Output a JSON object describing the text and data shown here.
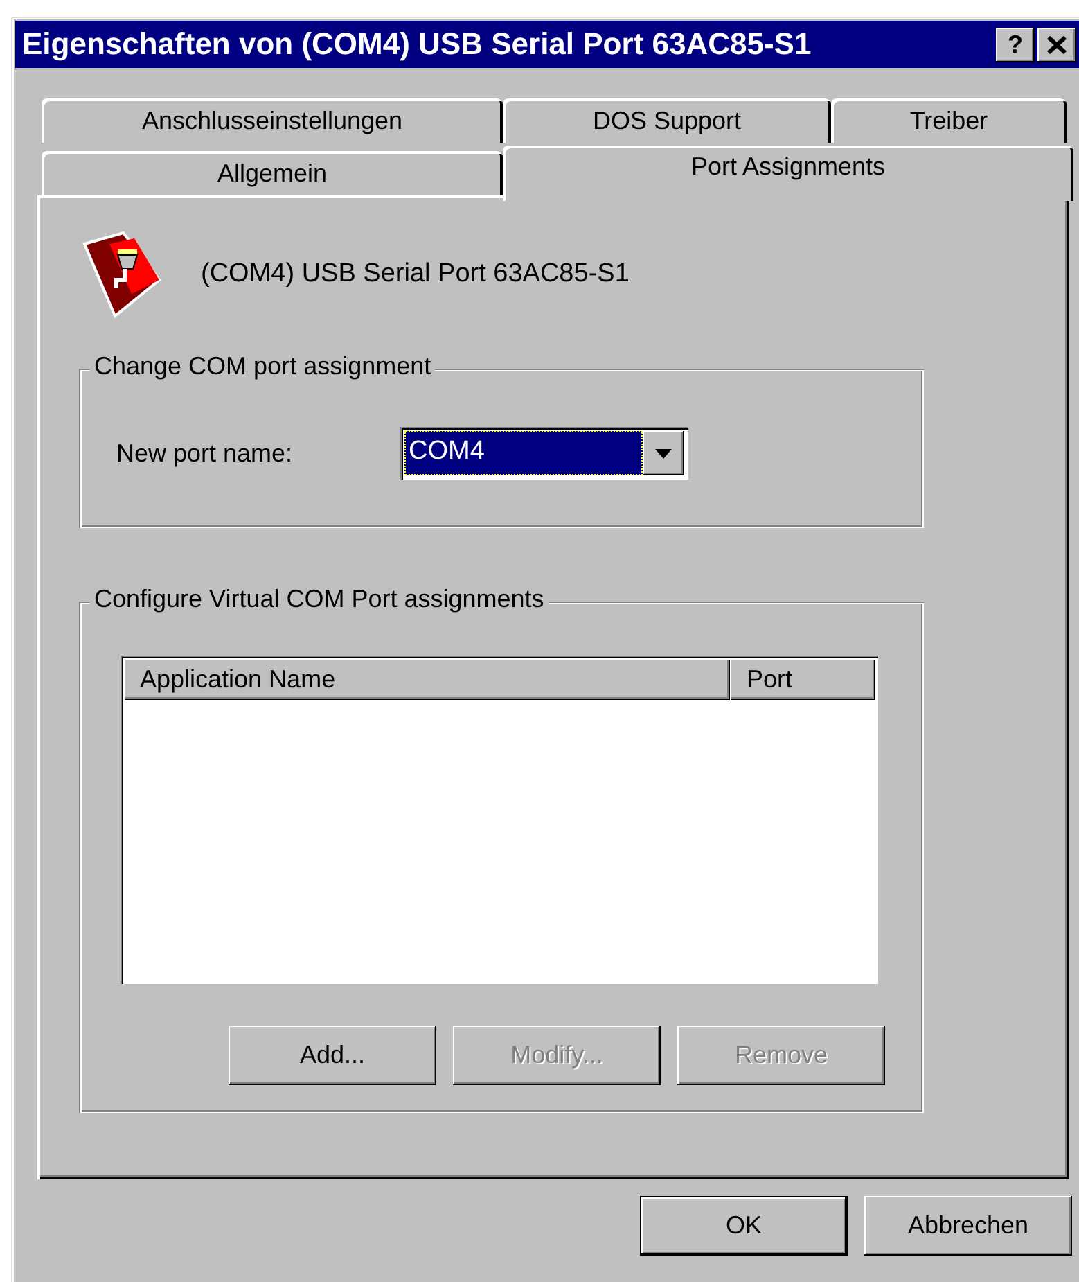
{
  "window": {
    "title": "Eigenschaften von (COM4) USB Serial Port 63AC85-S1",
    "help_button": "?"
  },
  "tab_rows": [
    {
      "tabs": [
        {
          "label": "Anschlusseinstellungen",
          "selected": false
        },
        {
          "label": "DOS Support",
          "selected": false
        },
        {
          "label": "Treiber",
          "selected": false
        }
      ]
    },
    {
      "tabs": [
        {
          "label": "Allgemein",
          "selected": false
        },
        {
          "label": "Port Assignments",
          "selected": true
        }
      ]
    }
  ],
  "device": {
    "name": "(COM4) USB Serial Port 63AC85-S1"
  },
  "port_group": {
    "legend": "Change COM port assignment",
    "label": "New port name:",
    "value": "COM4"
  },
  "vcp_group": {
    "legend": "Configure Virtual COM Port assignments",
    "columns": [
      "Application Name",
      "Port"
    ],
    "buttons": [
      {
        "label": "Add...",
        "disabled": false
      },
      {
        "label": "Modify...",
        "disabled": true
      },
      {
        "label": "Remove",
        "disabled": true
      }
    ]
  },
  "dialog_buttons": [
    {
      "label": "OK",
      "default": true
    },
    {
      "label": "Abbrechen",
      "default": false
    }
  ]
}
